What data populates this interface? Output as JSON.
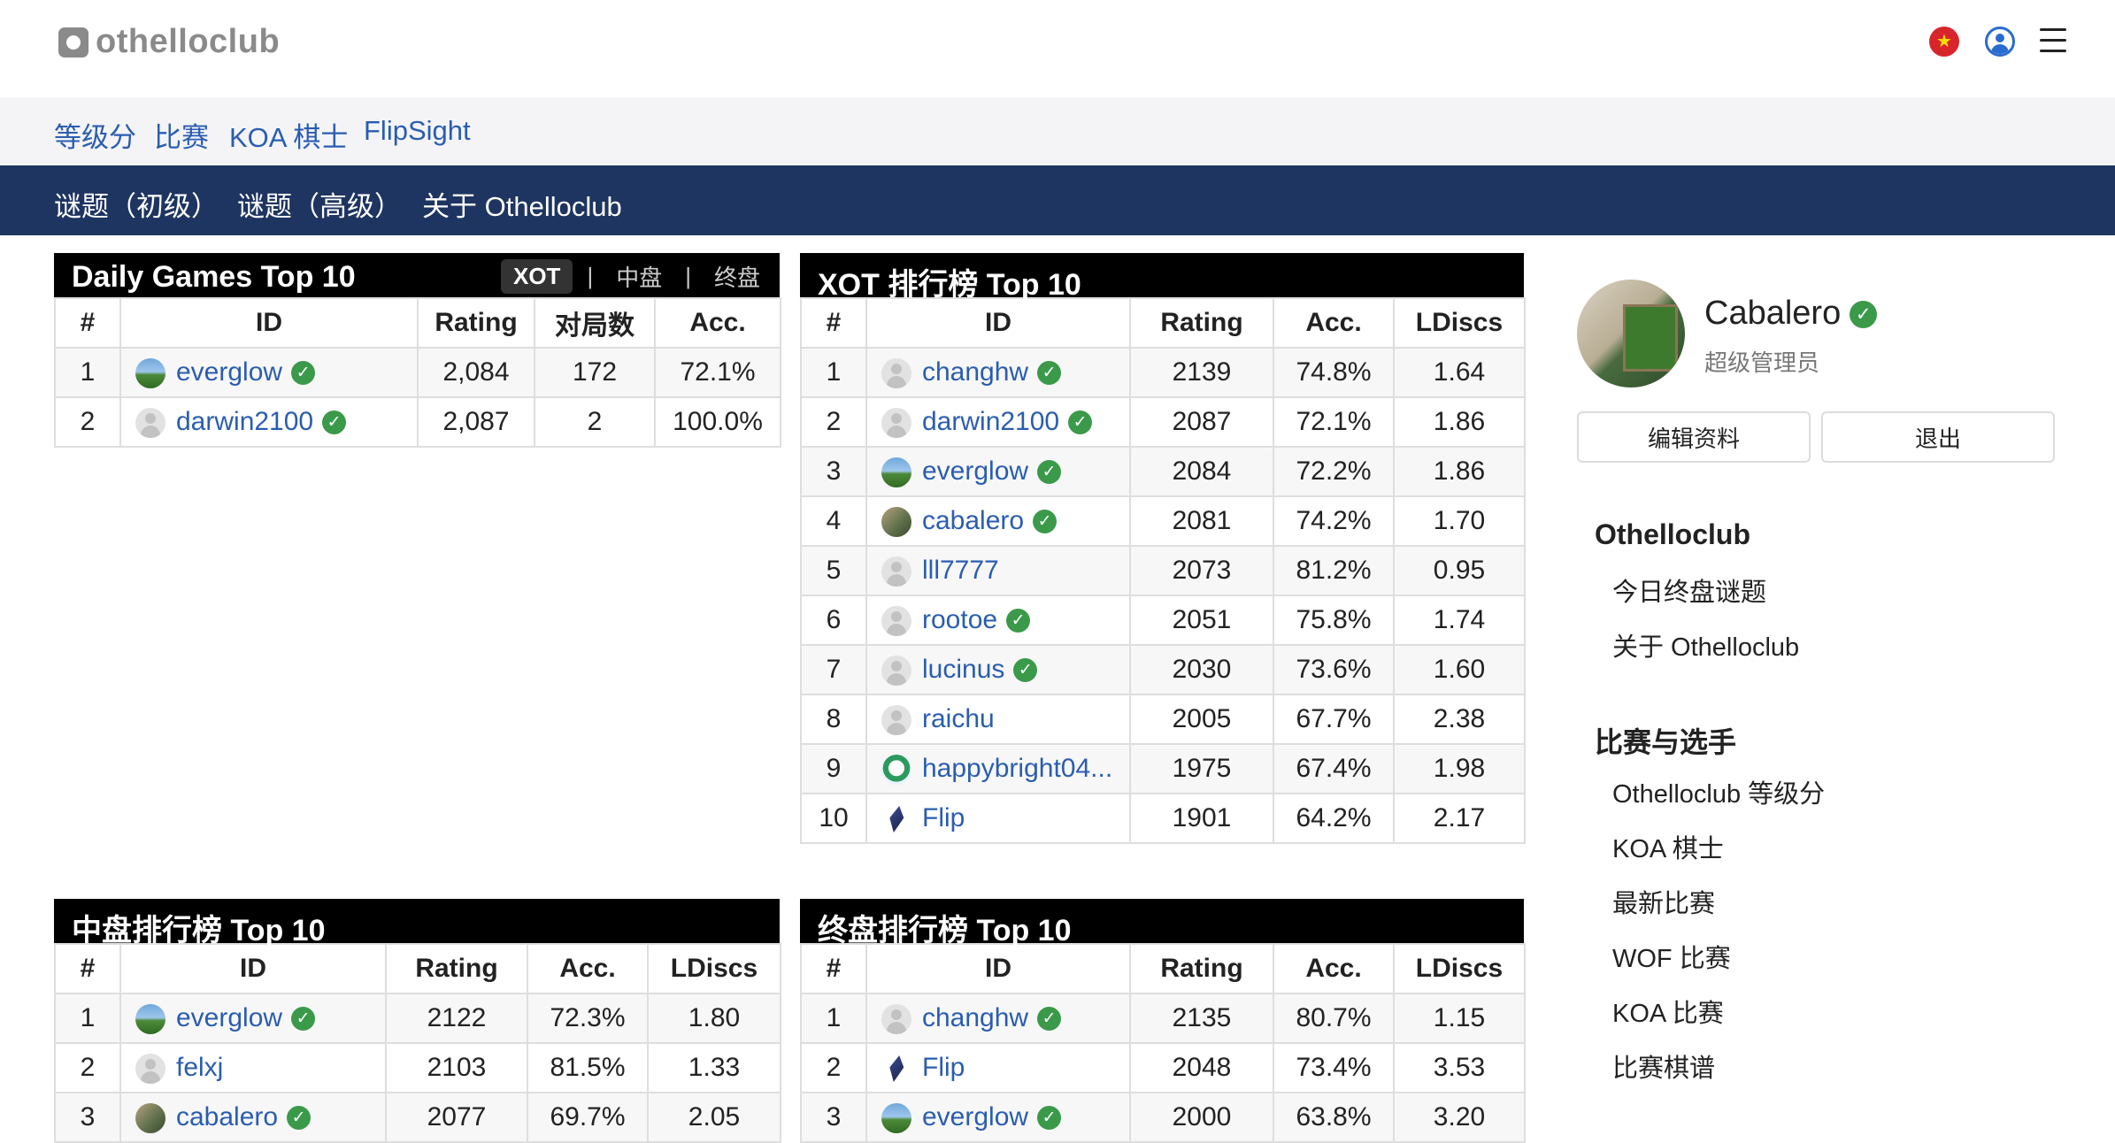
{
  "brand": {
    "name": "othelloclub"
  },
  "header_icons": {
    "flag": "china-flag-icon",
    "user": "user-circle-icon",
    "menu": "hamburger-menu-icon"
  },
  "nav_primary": [
    "等级分",
    "比赛",
    "KOA 棋士",
    "FlipSight"
  ],
  "nav_secondary": [
    "谜题（初级）",
    "谜题（高级）",
    "关于 Othelloclub"
  ],
  "daily": {
    "title": "Daily Games Top 10",
    "tabs": [
      "XOT",
      "中盘",
      "终盘"
    ],
    "active_tab": "XOT",
    "headers": [
      "#",
      "ID",
      "Rating",
      "对局数",
      "Acc."
    ],
    "rows": [
      {
        "rank": "1",
        "id": "everglow",
        "verified": true,
        "avatar": "landscape",
        "rating": "2,084",
        "games": "172",
        "acc": "72.1%"
      },
      {
        "rank": "2",
        "id": "darwin2100",
        "verified": true,
        "avatar": "default",
        "rating": "2,087",
        "games": "2",
        "acc": "100.0%"
      }
    ]
  },
  "xot": {
    "title": "XOT 排行榜 Top 10",
    "headers": [
      "#",
      "ID",
      "Rating",
      "Acc.",
      "LDiscs"
    ],
    "rows": [
      {
        "rank": "1",
        "id": "changhw",
        "verified": true,
        "avatar": "default",
        "rating": "2139",
        "acc": "74.8%",
        "ldiscs": "1.64"
      },
      {
        "rank": "2",
        "id": "darwin2100",
        "verified": true,
        "avatar": "default",
        "rating": "2087",
        "acc": "72.1%",
        "ldiscs": "1.86"
      },
      {
        "rank": "3",
        "id": "everglow",
        "verified": true,
        "avatar": "landscape",
        "rating": "2084",
        "acc": "72.2%",
        "ldiscs": "1.86"
      },
      {
        "rank": "4",
        "id": "cabalero",
        "verified": true,
        "avatar": "photo",
        "rating": "2081",
        "acc": "74.2%",
        "ldiscs": "1.70"
      },
      {
        "rank": "5",
        "id": "lll7777",
        "verified": false,
        "avatar": "default",
        "rating": "2073",
        "acc": "81.2%",
        "ldiscs": "0.95"
      },
      {
        "rank": "6",
        "id": "rootoe",
        "verified": true,
        "avatar": "default",
        "rating": "2051",
        "acc": "75.8%",
        "ldiscs": "1.74"
      },
      {
        "rank": "7",
        "id": "lucinus",
        "verified": true,
        "avatar": "default",
        "rating": "2030",
        "acc": "73.6%",
        "ldiscs": "1.60"
      },
      {
        "rank": "8",
        "id": "raichu",
        "verified": false,
        "avatar": "default",
        "rating": "2005",
        "acc": "67.7%",
        "ldiscs": "2.38"
      },
      {
        "rank": "9",
        "id": "happybright04...",
        "verified": false,
        "avatar": "cartoon",
        "rating": "1975",
        "acc": "67.4%",
        "ldiscs": "1.98"
      },
      {
        "rank": "10",
        "id": "Flip",
        "verified": false,
        "avatar": "flip",
        "rating": "1901",
        "acc": "64.2%",
        "ldiscs": "2.17"
      }
    ]
  },
  "midgame": {
    "title": "中盘排行榜 Top 10",
    "headers": [
      "#",
      "ID",
      "Rating",
      "Acc.",
      "LDiscs"
    ],
    "rows": [
      {
        "rank": "1",
        "id": "everglow",
        "verified": true,
        "avatar": "landscape",
        "rating": "2122",
        "acc": "72.3%",
        "ldiscs": "1.80"
      },
      {
        "rank": "2",
        "id": "felxj",
        "verified": false,
        "avatar": "default",
        "rating": "2103",
        "acc": "81.5%",
        "ldiscs": "1.33"
      },
      {
        "rank": "3",
        "id": "cabalero",
        "verified": true,
        "avatar": "photo",
        "rating": "2077",
        "acc": "69.7%",
        "ldiscs": "2.05"
      }
    ]
  },
  "endgame": {
    "title": "终盘排行榜 Top 10",
    "headers": [
      "#",
      "ID",
      "Rating",
      "Acc.",
      "LDiscs"
    ],
    "rows": [
      {
        "rank": "1",
        "id": "changhw",
        "verified": true,
        "avatar": "default",
        "rating": "2135",
        "acc": "80.7%",
        "ldiscs": "1.15"
      },
      {
        "rank": "2",
        "id": "Flip",
        "verified": false,
        "avatar": "flip",
        "rating": "2048",
        "acc": "73.4%",
        "ldiscs": "3.53"
      },
      {
        "rank": "3",
        "id": "everglow",
        "verified": true,
        "avatar": "landscape",
        "rating": "2000",
        "acc": "63.8%",
        "ldiscs": "3.20"
      }
    ]
  },
  "profile": {
    "name": "Cabalero",
    "verified": true,
    "role": "超级管理员",
    "edit_label": "编辑资料",
    "logout_label": "退出"
  },
  "sidebar": {
    "section1": {
      "title": "Othelloclub",
      "links": [
        "今日终盘谜题",
        "关于 Othelloclub"
      ]
    },
    "section2": {
      "title": "比赛与选手",
      "links": [
        "Othelloclub 等级分",
        "KOA 棋士",
        "最新比赛",
        "WOF 比赛",
        "KOA 比赛",
        "比赛棋谱"
      ]
    }
  },
  "colors": {
    "link": "#2a5db0",
    "nav_dark": "#1e3561",
    "nav_light": "#f4f4f6",
    "verified": "#3a9a4a",
    "table_header": "#000000"
  }
}
